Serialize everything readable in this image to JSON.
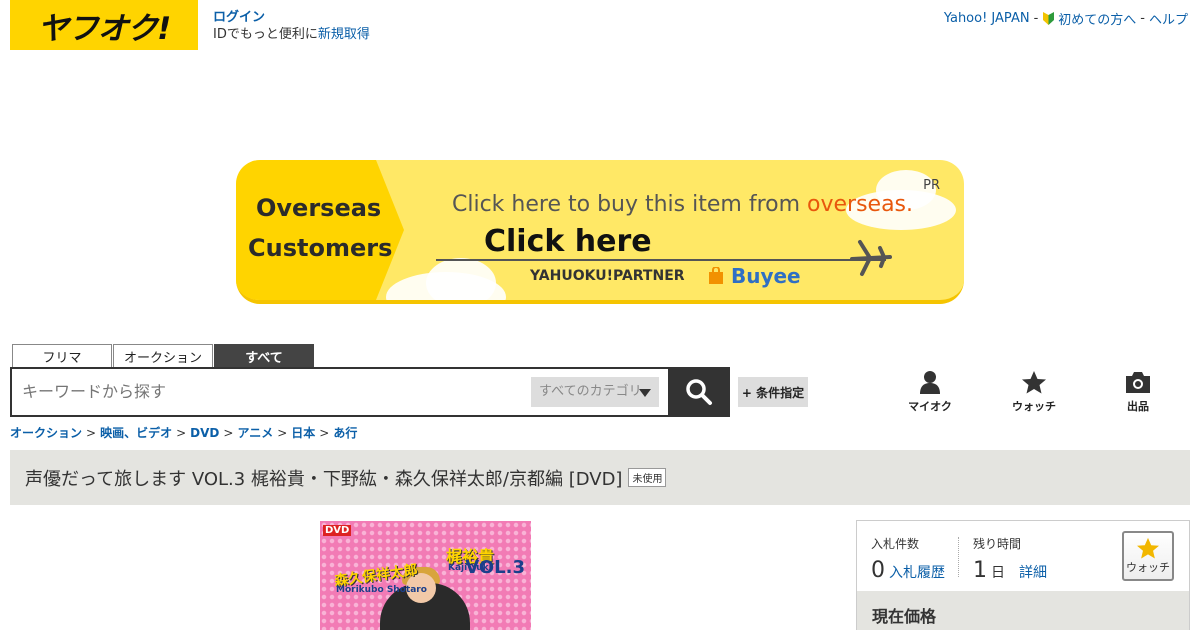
{
  "header": {
    "logo_text": "ヤフオク!",
    "login_label": "ログイン",
    "id_text": "IDでもっと便利に",
    "signup_label": "新規取得",
    "nav": {
      "yahoo_japan": "Yahoo! JAPAN",
      "sep1": "-",
      "beginners": "初めての方へ",
      "sep2": "-",
      "help": "ヘルプ"
    }
  },
  "banner": {
    "left_line1": "Overseas",
    "left_line2": "Customers",
    "pr": "PR",
    "headline_prefix": "Click here to buy this item from ",
    "headline_accent": "overseas.",
    "cta": "Click here",
    "partner": "YAHUOKU!PARTNER",
    "brand": "Buyee"
  },
  "search": {
    "tabs": [
      {
        "label": "フリマ",
        "active": false
      },
      {
        "label": "オークション",
        "active": false
      },
      {
        "label": "すべて",
        "active": true
      }
    ],
    "placeholder": "キーワードから探す",
    "category": "すべてのカテゴリ",
    "conditions_label": "+ 条件指定"
  },
  "quick_links": {
    "myauction": "マイオク",
    "watch": "ウォッチ",
    "sell": "出品"
  },
  "breadcrumb": {
    "items": [
      "オークション",
      "映画、ビデオ",
      "DVD",
      "アニメ",
      "日本",
      "あ行"
    ],
    "separator": ">"
  },
  "item": {
    "title": "声優だって旅します VOL.3 梶裕貴・下野紘・森久保祥太郎/京都編 [DVD]",
    "condition_badge": "未使用",
    "image": {
      "dvd_tag": "DVD",
      "name1": "森久保祥太郎",
      "name1_romaji": "Morikubo Shotaro",
      "name2": "梶裕貴",
      "name2_romaji": "Kaji Yuki",
      "vol": "VOL.3"
    }
  },
  "bid": {
    "bid_count_label": "入札件数",
    "bid_count": "0",
    "history_link": "入札履歴",
    "time_left_label": "残り時間",
    "time_left_value": "1",
    "time_left_unit": "日",
    "detail_link": "詳細",
    "watch_label": "ウォッチ",
    "current_price_label": "現在価格"
  },
  "colors": {
    "brand_yellow": "#ffd400",
    "link_blue": "#0b5fa8",
    "dark": "#333333",
    "title_bg": "#e4e4e0"
  }
}
